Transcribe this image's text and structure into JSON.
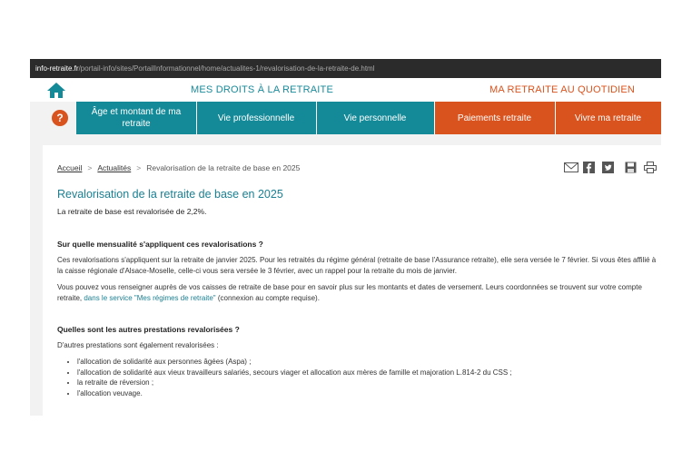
{
  "browser": {
    "url_host": "info-retraite.fr",
    "url_path": "/portail-info/sites/PortailInformationnel/home/actualites-1/revalorisation-de-la-retraite-de.html"
  },
  "header": {
    "left_title": "MES DROITS À LA RETRAITE",
    "right_title": "MA RETRAITE AU QUOTIDIEN",
    "help_glyph": "?"
  },
  "nav": {
    "items": [
      {
        "label": "Âge et montant de ma retraite",
        "color": "#148a98"
      },
      {
        "label": "Vie professionnelle",
        "color": "#148a98"
      },
      {
        "label": "Vie personnelle",
        "color": "#148a98"
      },
      {
        "label": "Paiements retraite",
        "color": "#d9531e"
      },
      {
        "label": "Vivre ma retraite",
        "color": "#d9531e"
      }
    ]
  },
  "breadcrumb": {
    "home": "Accueil",
    "section": "Actualités",
    "current": "Revalorisation de la retraite de base en 2025"
  },
  "tools": [
    "mail-icon",
    "facebook-icon",
    "twitter-icon",
    "save-icon",
    "print-icon"
  ],
  "article": {
    "title": "Revalorisation de la retraite de base en 2025",
    "lead": "La retraite de base est revalorisée de 2,2%.",
    "section1_heading": "Sur quelle mensualité s'appliquent ces revalorisations ?",
    "section1_p1": "Ces revalorisations s'appliquent sur la retraite de janvier 2025. Pour les retraités du régime général (retraite de base l'Assurance retraite), elle sera versée le 7 février. Si vous êtes affilié à la caisse régionale d'Alsace-Moselle, celle-ci vous sera versée le 3 février, avec un rappel pour la retraite du mois de janvier.",
    "section1_p2_before": "Vous pouvez vous renseigner auprès de vos caisses de retraite de base pour en savoir plus sur les montants et dates de versement. Leurs coordonnées se trouvent sur votre compte retraite, ",
    "section1_p2_link": "dans le service \"Mes régimes de retraite\"",
    "section1_p2_after": " (connexion au compte requise).",
    "section2_heading": "Quelles sont les autres prestations revalorisées ?",
    "section2_intro": "D'autres prestations sont également revalorisées :",
    "section2_list": [
      "l'allocation de solidarité aux personnes âgées (Aspa) ;",
      "l'allocation de solidarité aux vieux travailleurs salariés, secours viager et allocation aux mères de famille et majoration L.814-2 du CSS ;",
      "la retraite de réversion ;",
      "l'allocation veuvage."
    ]
  },
  "colors": {
    "teal": "#148a98",
    "orange": "#d9531e",
    "title_blue": "#1a7f92",
    "url_bar": "#2b2b2b"
  }
}
